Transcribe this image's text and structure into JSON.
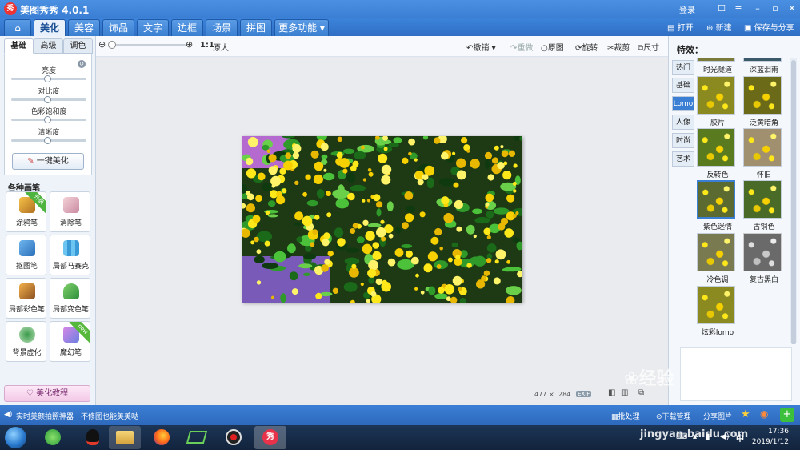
{
  "window": {
    "title": "美图秀秀 4.0.1",
    "logo_text": "秀",
    "login": "登录",
    "open": "打开",
    "new": "新建",
    "save_share": "保存与分享"
  },
  "menu": {
    "tabs": [
      "美化",
      "美容",
      "饰品",
      "文字",
      "边框",
      "场景",
      "拼图",
      "更多功能"
    ],
    "active": "美化"
  },
  "left": {
    "subtabs": [
      "基础",
      "高级",
      "调色"
    ],
    "adjustments": [
      "亮度",
      "对比度",
      "色彩饱和度",
      "清晰度"
    ],
    "oneclick": "一键美化",
    "brushes_title": "各种画笔",
    "brushes": [
      {
        "label": "涂鸦笔",
        "badge": "升级"
      },
      {
        "label": "消除笔",
        "badge": ""
      },
      {
        "label": "抠图笔",
        "badge": ""
      },
      {
        "label": "局部马赛克",
        "badge": ""
      },
      {
        "label": "局部彩色笔",
        "badge": ""
      },
      {
        "label": "局部变色笔",
        "badge": ""
      },
      {
        "label": "背景虚化",
        "badge": ""
      },
      {
        "label": "魔幻笔",
        "badge": "new"
      }
    ],
    "tutorial": "美化教程"
  },
  "toolbar": {
    "ratio": "1:1",
    "original_size": "原大",
    "undo": "撤销",
    "redo": "重做",
    "original": "原图",
    "rotate": "旋转",
    "crop": "裁剪",
    "size": "尺寸"
  },
  "canvas": {
    "width": "477",
    "times": "×",
    "height": "284",
    "exif": "EXIF"
  },
  "right": {
    "title": "特效：",
    "categories": [
      "热门",
      "基础",
      "Lomo",
      "人像",
      "时尚",
      "艺术"
    ],
    "active_category": "Lomo",
    "effects": [
      {
        "label": "时光隧道",
        "tint": "#7a7a3a"
      },
      {
        "label": "深蓝泪雨",
        "tint": "#3a5a6a"
      },
      {
        "label": "胶片",
        "tint": "#8a8a20"
      },
      {
        "label": "泛黄暗角",
        "tint": "#6a6a18"
      },
      {
        "label": "反转色",
        "tint": "#5a7a20"
      },
      {
        "label": "怀旧",
        "tint": "#a09070"
      },
      {
        "label": "紫色迷情",
        "tint": "#5a6a30"
      },
      {
        "label": "古铜色",
        "tint": "#4a6a28"
      },
      {
        "label": "冷色调",
        "tint": "#7a7a50"
      },
      {
        "label": "复古黑白",
        "tint": "#6a6a6a"
      },
      {
        "label": "炫彩lomo",
        "tint": "#8a8a20"
      }
    ],
    "selected_effect": "紫色迷情"
  },
  "status": {
    "message": "实时美颜拍照神器一不修图也能美美哒",
    "batch": "批处理",
    "download": "下载管理",
    "share": "分享图片"
  },
  "taskbar": {
    "time": "17:36",
    "date": "2019/1/12",
    "active_app": "秀"
  },
  "watermark": {
    "text": "经验",
    "url": "jingyan.baidu.com"
  }
}
